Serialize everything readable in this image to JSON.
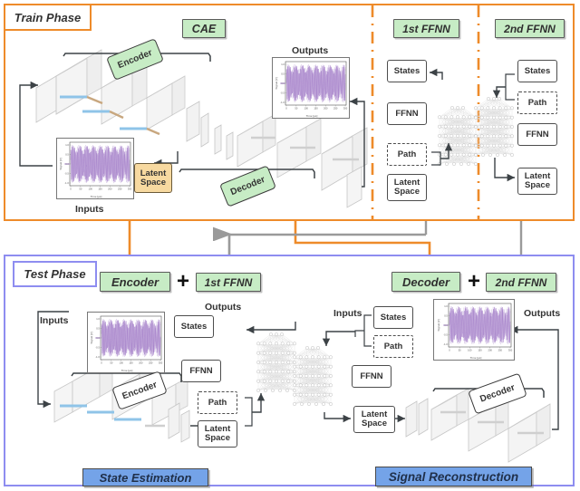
{
  "train": {
    "tab_label": "Train Phase",
    "cae_label": "CAE",
    "ffnn1_label": "1st FFNN",
    "ffnn2_label": "2nd FFNN",
    "encoder_tag": "Encoder",
    "decoder_tag": "Decoder",
    "latent_space": "Latent\nSpace",
    "inputs_label": "Inputs",
    "outputs_label": "Outputs",
    "ffnn1_nodes": [
      "States",
      "FFNN",
      "Path",
      "Latent\nSpace"
    ],
    "ffnn2_nodes": [
      "States",
      "Path",
      "FFNN",
      "Latent\nSpace"
    ]
  },
  "test": {
    "tab_label": "Test Phase",
    "left": {
      "chip_a": "Encoder",
      "plus": "+",
      "chip_b": "1st FFNN",
      "inputs_label": "Inputs",
      "outputs_label": "Outputs",
      "encoder_tag": "Encoder",
      "nodes": [
        "States",
        "FFNN",
        "Path",
        "Latent\nSpace"
      ],
      "result": "State Estimation"
    },
    "right": {
      "chip_a": "Decoder",
      "plus": "+",
      "chip_b": "2nd FFNN",
      "inputs_label": "Inputs",
      "outputs_label": "Outputs",
      "decoder_tag": "Decoder",
      "nodes": [
        "States",
        "Path",
        "FFNN",
        "Latent\nSpace"
      ],
      "result": "Signal Reconstruction"
    }
  },
  "plots": {
    "xlabel": "Time [µs]",
    "ylabel": "Signal [V]",
    "xticks": [
      "0",
      "50",
      "100",
      "150",
      "200",
      "250",
      "300"
    ],
    "yticks": [
      "1.0",
      "0.5",
      "0.0",
      "-0.5",
      "-1.0"
    ]
  },
  "colors": {
    "train_border": "#ee8b2a",
    "test_border": "#8e8df0",
    "chip_green": "#c7ecc5",
    "chip_blue": "#74a3e8",
    "latent_tan": "#f7d9a0",
    "signal_purple": "#9b72c4",
    "arrow_gray": "#9a9a9a",
    "line_dark": "#3c4246"
  }
}
